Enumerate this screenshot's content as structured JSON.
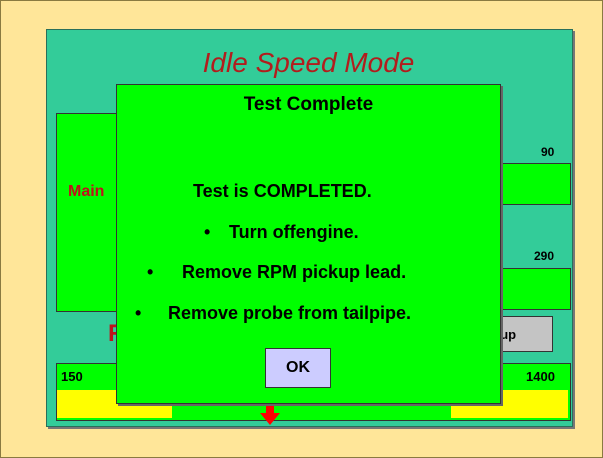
{
  "screen": {
    "title": "Idle Speed Mode",
    "main_label": "Main",
    "value_top_right": "90",
    "value_mid_right": "290",
    "pickup_button_label": "kup",
    "r_label": "R",
    "bar_min_label": "150",
    "bar_max_label": "1400",
    "arrow_icon": "down-arrow-icon"
  },
  "dialog": {
    "title": "Test Complete",
    "message": "Test is COMPLETED.",
    "bullets": [
      "Turn offengine.",
      "Remove RPM pickup lead.",
      "Remove probe from tailpipe."
    ],
    "ok_label": "OK"
  },
  "colors": {
    "background": "#ffe699",
    "panel": "#33cc99",
    "dialog": "#00ff00",
    "title_red": "#b21d1d",
    "yellow_zone": "#ffff00",
    "ok_button": "#ccccff"
  }
}
